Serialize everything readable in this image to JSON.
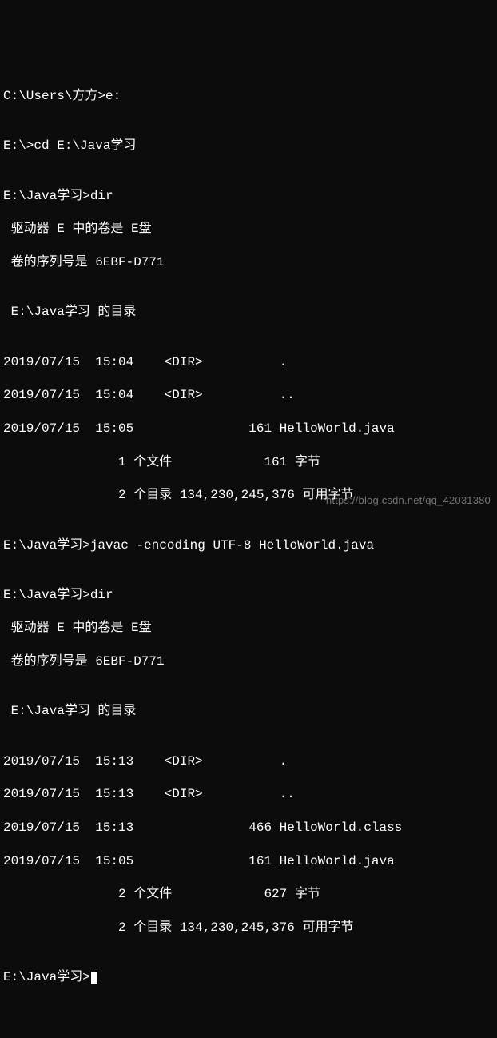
{
  "lines": {
    "l1_prompt": "C:\\Users\\方方>",
    "l1_cmd": "e:",
    "blank1": "",
    "l2_prompt": "E:\\>",
    "l2_cmd": "cd E:\\Java学习",
    "blank2": "",
    "l3_prompt": "E:\\Java学习>",
    "l3_cmd": "dir",
    "l4": " 驱动器 E 中的卷是 E盘",
    "l5": " 卷的序列号是 6EBF-D771",
    "blank3": "",
    "l6": " E:\\Java学习 的目录",
    "blank4": "",
    "l7": "2019/07/15  15:04    <DIR>          .",
    "l8": "2019/07/15  15:04    <DIR>          ..",
    "l9": "2019/07/15  15:05               161 HelloWorld.java",
    "l10": "               1 个文件            161 字节",
    "l11": "               2 个目录 134,230,245,376 可用字节",
    "blank5": "",
    "l12_prompt": "E:\\Java学习>",
    "l12_cmd": "javac -encoding UTF-8 HelloWorld.java",
    "blank6": "",
    "l13_prompt": "E:\\Java学习>",
    "l13_cmd": "dir",
    "l14": " 驱动器 E 中的卷是 E盘",
    "l15": " 卷的序列号是 6EBF-D771",
    "blank7": "",
    "l16": " E:\\Java学习 的目录",
    "blank8": "",
    "l17": "2019/07/15  15:13    <DIR>          .",
    "l18": "2019/07/15  15:13    <DIR>          ..",
    "l19": "2019/07/15  15:13               466 HelloWorld.class",
    "l20": "2019/07/15  15:05               161 HelloWorld.java",
    "l21": "               2 个文件            627 字节",
    "l22": "               2 个目录 134,230,245,376 可用字节",
    "blank9": "",
    "l23_prompt": "E:\\Java学习>"
  },
  "watermark": "https://blog.csdn.net/qq_42031380"
}
